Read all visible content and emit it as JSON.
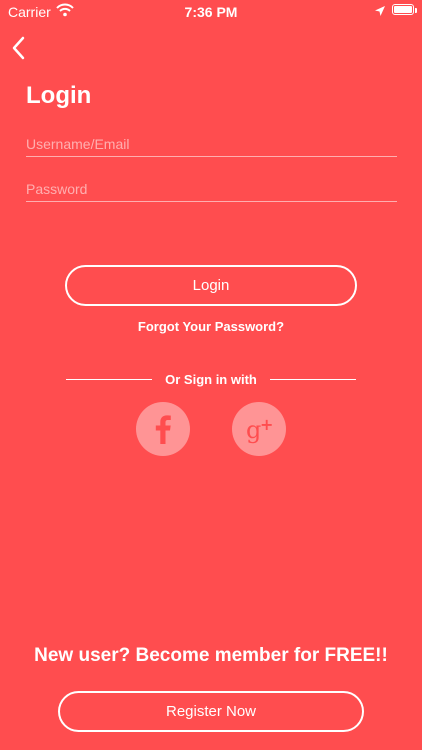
{
  "status_bar": {
    "carrier": "Carrier",
    "time": "7:36 PM"
  },
  "header": {
    "title": "Login"
  },
  "form": {
    "username_placeholder": "Username/Email",
    "password_placeholder": "Password"
  },
  "actions": {
    "login_label": "Login",
    "forgot_label": "Forgot Your Password?",
    "social_divider": "Or Sign in with"
  },
  "social": [
    {
      "name": "facebook-icon"
    },
    {
      "name": "google-plus-icon"
    }
  ],
  "footer": {
    "prompt": "New user? Become member for FREE!!",
    "register_label": "Register Now"
  },
  "colors": {
    "background": "#FF4D4F",
    "social_icon": "#FF4D4F"
  }
}
